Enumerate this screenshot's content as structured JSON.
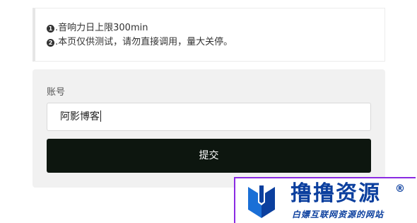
{
  "notice": {
    "line1_bullet": "1",
    "line1_text": ".音响力日上限300min",
    "line2_bullet": "2",
    "line2_text": ".本页仅供测试，请勿直接调用，量大关停。"
  },
  "form": {
    "account_label": "账号",
    "account_value": "阿影博客",
    "submit_label": "提交"
  },
  "watermark": {
    "logo_icon": "brand-logo-icon",
    "title": "撸撸资源",
    "registered": "®",
    "subtitle": "白嫖互联网资源的网站",
    "color": "#0b3f9e"
  }
}
